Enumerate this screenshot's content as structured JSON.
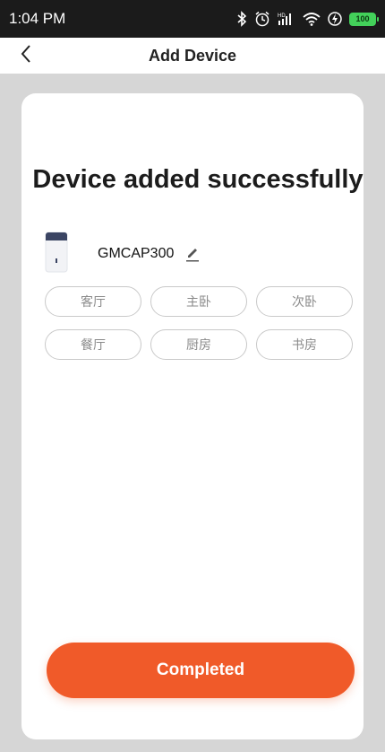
{
  "status_bar": {
    "time": "1:04 PM",
    "battery": "100",
    "icons": [
      "bluetooth-icon",
      "alarm-icon",
      "signal-icon",
      "wifi-icon",
      "charging-icon",
      "battery-icon"
    ]
  },
  "header": {
    "title": "Add Device",
    "back_icon": "chevron-left-icon"
  },
  "main": {
    "title": "Device added successfully",
    "device": {
      "name": "GMCAP300",
      "image": "dehumidifier-image",
      "edit_icon": "pencil-icon"
    },
    "rooms": [
      "客厅",
      "主卧",
      "次卧",
      "餐厅",
      "厨房",
      "书房"
    ]
  },
  "footer": {
    "completed_label": "Completed"
  },
  "colors": {
    "accent": "#f05a29",
    "battery": "#43d15a",
    "status_bar": "#1b1b1b",
    "background": "#d6d6d6"
  }
}
